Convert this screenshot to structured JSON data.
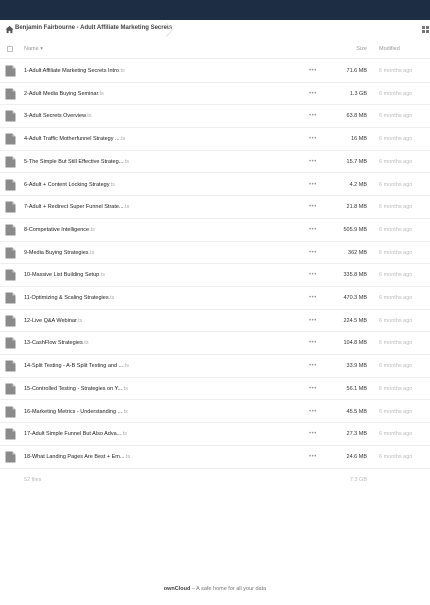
{
  "breadcrumb": {
    "label": "Benjamin Fairbourne - Adult Affiliate Marketing Secrets"
  },
  "icons": {
    "home": "home-icon",
    "view_toggle": "grid-view-icon",
    "file": "file-icon",
    "more": "more-icon"
  },
  "columns": {
    "name": "Name",
    "size": "Size",
    "modified": "Modified"
  },
  "files": [
    {
      "name": "1-Adult Affiliate Marketing Secrets Intro",
      "ext": ".ts",
      "size": "71.6 MB",
      "modified": "6 months ago"
    },
    {
      "name": "2-Adult Media Buying Seminar",
      "ext": ".ts",
      "size": "1.3 GB",
      "modified": "6 months ago"
    },
    {
      "name": "3-Adult Secrets Overview",
      "ext": ".ts",
      "size": "63.8 MB",
      "modified": "6 months ago"
    },
    {
      "name": "4-Adult Traffic Motherfunnel Strategy ...",
      "ext": ".ts",
      "size": "16 MB",
      "modified": "6 months ago"
    },
    {
      "name": "5-The Simple But Still Effective Strateg...",
      "ext": ".ts",
      "size": "15.7 MB",
      "modified": "6 months ago"
    },
    {
      "name": "6-Adult + Content Locking Strategy",
      "ext": ".ts",
      "size": "4.2 MB",
      "modified": "6 months ago"
    },
    {
      "name": "7-Adult + Redirect Super Funnel Strate...",
      "ext": ".ts",
      "size": "21.8 MB",
      "modified": "6 months ago"
    },
    {
      "name": "8-Competative Intelligence",
      "ext": ".ts",
      "size": "505.9 MB",
      "modified": "6 months ago"
    },
    {
      "name": "9-Media Buying Strategies",
      "ext": ".ts",
      "size": "362 MB",
      "modified": "6 months ago"
    },
    {
      "name": "10-Massive List Building Setup",
      "ext": ".ts",
      "size": "335.8 MB",
      "modified": "6 months ago"
    },
    {
      "name": "11-Optimizing & Scaling Strategies",
      "ext": ".ts",
      "size": "470.3 MB",
      "modified": "6 months ago"
    },
    {
      "name": "12-Live Q&A Webinar",
      "ext": ".ts",
      "size": "224.5 MB",
      "modified": "6 months ago"
    },
    {
      "name": "13-CashFlow Strategies",
      "ext": ".ts",
      "size": "104.8 MB",
      "modified": "6 months ago"
    },
    {
      "name": "14-Split Testing - A-B Split Testing and ...",
      "ext": ".ts",
      "size": "33.9 MB",
      "modified": "6 months ago"
    },
    {
      "name": "15-Controlled Testing - Strategies on Y...",
      "ext": ".ts",
      "size": "56.1 MB",
      "modified": "6 months ago"
    },
    {
      "name": "16-Marketing Metrics - Understanding ...",
      "ext": ".ts",
      "size": "45.5 MB",
      "modified": "6 months ago"
    },
    {
      "name": "17-Adult Simple Funnel But Also Adva...",
      "ext": ".ts",
      "size": "27.3 MB",
      "modified": "6 months ago"
    },
    {
      "name": "18-What Landing Pages Are Best + Em...",
      "ext": ".ts",
      "size": "24.6 MB",
      "modified": "6 months ago"
    }
  ],
  "summary": {
    "count": "52 files",
    "total": "7.3 GB"
  },
  "footer": {
    "brand": "ownCloud",
    "tagline": " – A safe home for all your data"
  }
}
